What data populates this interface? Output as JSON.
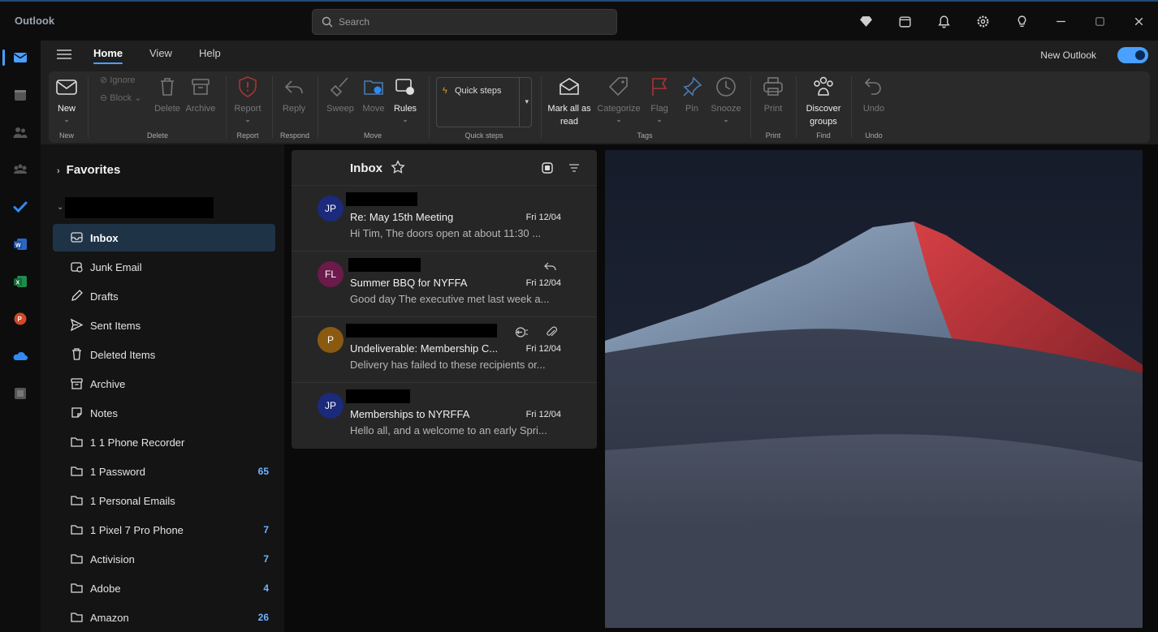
{
  "titlebar": {
    "app_name": "Outlook",
    "search_placeholder": "Search",
    "icons": [
      "diamond-icon",
      "calendar-note-icon",
      "bell-icon",
      "settings-icon",
      "lightbulb-icon",
      "minimize-icon",
      "maximize-icon",
      "close-icon"
    ]
  },
  "rail": {
    "items": [
      "mail-icon",
      "calendar-icon",
      "people-icon",
      "groups-icon",
      "todo-icon",
      "word-icon",
      "excel-icon",
      "powerpoint-icon",
      "onedrive-icon",
      "apps-icon"
    ]
  },
  "ribbon": {
    "tabs": [
      "Home",
      "View",
      "Help"
    ],
    "new_outlook_label": "New Outlook",
    "new_outlook_on": true,
    "tools": {
      "new": "New",
      "ignore": "Ignore",
      "block": "Block",
      "delete": "Delete",
      "archive": "Archive",
      "report": "Report",
      "reply": "Reply",
      "sweep": "Sweep",
      "move": "Move",
      "rules": "Rules",
      "quick_steps": "Quick steps",
      "mark_all_read_1": "Mark all as",
      "mark_all_read_2": "read",
      "categorize": "Categorize",
      "flag": "Flag",
      "pin": "Pin",
      "snooze": "Snooze",
      "print": "Print",
      "discover_1": "Discover",
      "discover_2": "groups",
      "undo": "Undo"
    },
    "groups": {
      "new": "New",
      "delete": "Delete",
      "report": "Report",
      "respond": "Respond",
      "move": "Move",
      "quick_steps": "Quick steps",
      "tags": "Tags",
      "print": "Print",
      "find": "Find",
      "undo": "Undo"
    }
  },
  "folders": {
    "favorites_label": "Favorites",
    "items": [
      {
        "name": "Inbox",
        "icon": "inbox-icon",
        "count": ""
      },
      {
        "name": "Junk Email",
        "icon": "junk-icon",
        "count": ""
      },
      {
        "name": "Drafts",
        "icon": "pencil-icon",
        "count": ""
      },
      {
        "name": "Sent Items",
        "icon": "send-icon",
        "count": ""
      },
      {
        "name": "Deleted Items",
        "icon": "trash-icon",
        "count": ""
      },
      {
        "name": "Archive",
        "icon": "archive-icon",
        "count": ""
      },
      {
        "name": "Notes",
        "icon": "note-icon",
        "count": ""
      },
      {
        "name": "1 1 Phone Recorder",
        "icon": "folder-icon",
        "count": ""
      },
      {
        "name": "1 Password",
        "icon": "folder-icon",
        "count": "65"
      },
      {
        "name": "1 Personal Emails",
        "icon": "folder-icon",
        "count": ""
      },
      {
        "name": "1 Pixel 7 Pro Phone",
        "icon": "folder-icon",
        "count": "7"
      },
      {
        "name": "Activision",
        "icon": "folder-icon",
        "count": "7"
      },
      {
        "name": "Adobe",
        "icon": "folder-icon",
        "count": "4"
      },
      {
        "name": "Amazon",
        "icon": "folder-icon",
        "count": "26"
      }
    ]
  },
  "message_list": {
    "title": "Inbox",
    "messages": [
      {
        "initials": "JP",
        "avatar_color": "#1b2a7a",
        "subject": "Re: May 15th Meeting",
        "date": "Fri 12/04",
        "preview": "Hi Tim, The doors open at about 11:30 ..."
      },
      {
        "initials": "FL",
        "avatar_color": "#6b1a4a",
        "subject": "Summer BBQ for NYFFA",
        "date": "Fri 12/04",
        "preview": "Good day The executive met last week a..."
      },
      {
        "initials": "P",
        "avatar_color": "#8a5a10",
        "subject": "Undeliverable: Membership C...",
        "date": "Fri 12/04",
        "preview": "Delivery has failed to these recipients or..."
      },
      {
        "initials": "JP",
        "avatar_color": "#1b2a7a",
        "subject": "Memberships to NYRFFA",
        "date": "Fri 12/04",
        "preview": "Hello all, and a welcome to an early Spri..."
      }
    ]
  },
  "colors": {
    "accent": "#4aa0ff",
    "count": "#6fb4ff",
    "selected_folder": "#1f3347"
  }
}
